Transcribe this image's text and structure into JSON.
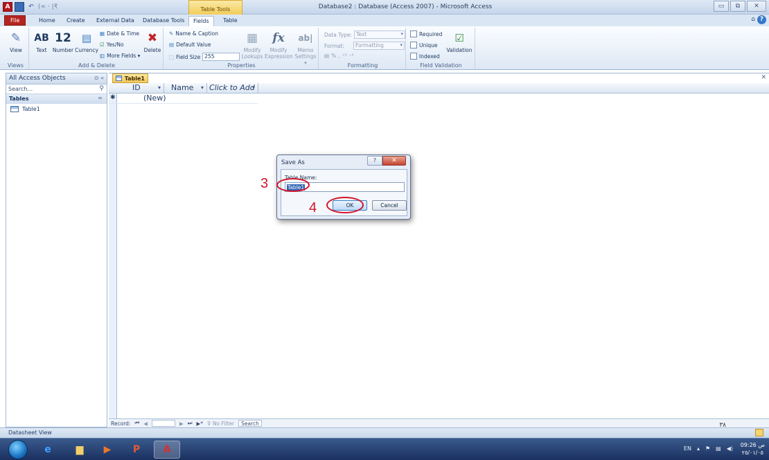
{
  "window": {
    "title": "Database2 : Database (Access 2007) - Microsoft Access",
    "context_tab": "Table Tools",
    "buttons": {
      "minimize": "▭",
      "restore": "⧉",
      "close": "✕"
    }
  },
  "qat": {
    "logo": "A",
    "separator": "(≈ · |₹"
  },
  "ribbon_tabs": [
    "File",
    "Home",
    "Create",
    "External Data",
    "Database Tools",
    "Fields",
    "Table"
  ],
  "ribbon": {
    "views": {
      "view_label": "View",
      "group": "Views"
    },
    "add_delete": {
      "text": "Text",
      "number": "Number",
      "currency": "Currency",
      "date_time": "Date & Time",
      "yes_no": "Yes/No",
      "more_fields": "More Fields ▾",
      "delete": "Delete",
      "group": "Add & Delete",
      "ab_glyph": "AB",
      "twelve_glyph": "12"
    },
    "properties": {
      "name_caption": "Name & Caption",
      "default_value": "Default Value",
      "field_size_label": "Field Size",
      "field_size_value": "255",
      "modify_lookups_1": "Modify",
      "modify_lookups_2": "Lookups",
      "modify_expression_1": "Modify",
      "modify_expression_2": "Expression",
      "memo_settings_1": "Memo",
      "memo_settings_2": "Settings ▾",
      "group": "Properties"
    },
    "formatting": {
      "data_type_label": "Data Type:",
      "data_type_value": "Text",
      "format_label": "Format:",
      "format_value": "Formatting",
      "group": "Formatting"
    },
    "field_validation": {
      "required": "Required",
      "unique": "Unique",
      "indexed": "Indexed",
      "validation": "Validation",
      "group": "Field Validation"
    }
  },
  "nav": {
    "header": "All Access Objects",
    "header_controls": "⊙ «",
    "search_placeholder": "Search...",
    "group": "Tables",
    "group_chevron": "≈",
    "items": [
      "Table1"
    ]
  },
  "document": {
    "tab": "Table1",
    "columns": [
      "ID",
      "Name",
      "Click to Add"
    ],
    "new_row": "(New)"
  },
  "record_nav": {
    "label": "Record:",
    "first": "⏮",
    "prev": "◀",
    "next": "▶",
    "last": "⏭",
    "new": "▶*",
    "no_filter": "No Filter",
    "search": "Search"
  },
  "dialog": {
    "title": "Save As",
    "help": "?",
    "close": "✕",
    "label": "Table Name:",
    "value": "Table1",
    "ok": "OK",
    "cancel": "Cancel"
  },
  "annotations": {
    "step3": "3",
    "step4": "4"
  },
  "status": {
    "text": "Datasheet View",
    "page_number": "٣٨"
  },
  "taskbar": {
    "tray_lang": "EN",
    "time": "09:26 ص",
    "date": "٢٥/٠١/٠٥"
  }
}
